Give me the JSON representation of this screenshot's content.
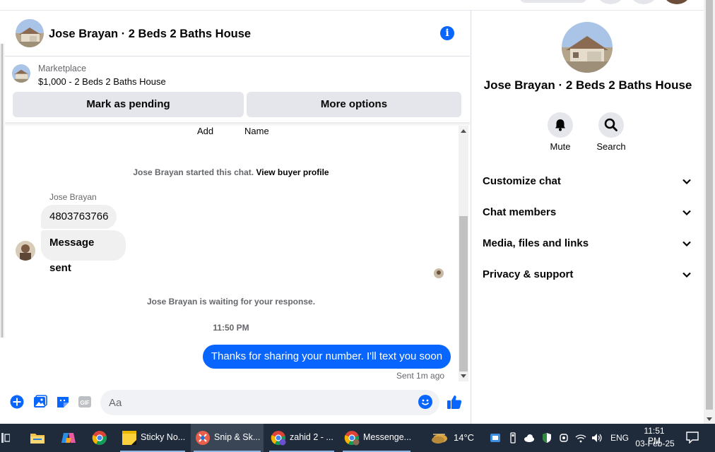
{
  "chat": {
    "title": "Jose Brayan · 2 Beds 2 Baths House",
    "marketplace_label": "Marketplace",
    "listing": "$1,000 - 2 Beds 2 Baths House",
    "mark_pending_label": "Mark as pending",
    "more_options_label": "More options",
    "cutoff_add": "Add",
    "cutoff_name": "Name",
    "started_text": "Jose Brayan started this chat.",
    "view_buyer_profile": "View buyer profile",
    "sender_name": "Jose Brayan",
    "messages_in": [
      "4803763766",
      "Message sent"
    ],
    "waiting_text": "Jose Brayan is waiting for your response.",
    "timestamp": "11:50 PM",
    "message_out": "Thanks for sharing your number. I'll text you soon",
    "sent_status": "Sent 1m ago",
    "composer_placeholder": "Aa"
  },
  "info_panel": {
    "title": "Jose Brayan · 2 Beds 2 Baths House",
    "mute_label": "Mute",
    "search_label": "Search",
    "sections": [
      {
        "label": "Customize chat"
      },
      {
        "label": "Chat members"
      },
      {
        "label": "Media, files and links"
      },
      {
        "label": "Privacy & support"
      }
    ]
  },
  "taskbar": {
    "apps": [
      {
        "name": "file-explorer",
        "label": ""
      },
      {
        "name": "copilot",
        "label": ""
      },
      {
        "name": "chrome",
        "label": ""
      },
      {
        "name": "sticky-notes",
        "label": "Sticky No..."
      },
      {
        "name": "snip-sketch",
        "label": "Snip & Sk..."
      },
      {
        "name": "chrome-zahid",
        "label": "zahid 2 - ..."
      },
      {
        "name": "chrome-messenger",
        "label": "Messenge..."
      }
    ],
    "weather": "14°C",
    "language": "ENG",
    "time": "11:51 PM",
    "date": "03-Feb-25"
  },
  "colors": {
    "accent": "#0866ff",
    "bubble_in": "#f0f0f0",
    "button_bg": "#e4e6eb",
    "taskbar_bg": "#1f2a3a"
  }
}
